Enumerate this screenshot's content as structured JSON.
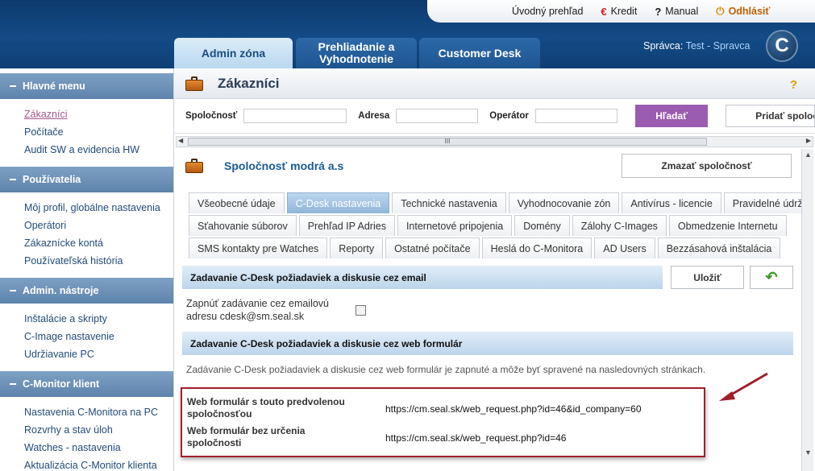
{
  "header": {
    "top_links": [
      {
        "label": "Úvodný prehľad",
        "icon": "none"
      },
      {
        "label": "Kredit",
        "icon": "credit-icon"
      },
      {
        "label": "Manual",
        "icon": "question-icon"
      },
      {
        "label": "Odhlásiť",
        "icon": "power-icon"
      }
    ],
    "tabs": [
      {
        "label": "Admin zóna"
      },
      {
        "label": "Prehliadanie a Vyhodnotenie"
      },
      {
        "label": "Customer Desk"
      }
    ],
    "admin_prefix": "Správca:",
    "admin_name": "Test - Spravca",
    "logo_letter": "C"
  },
  "sidebar": {
    "sections": [
      {
        "title": "Hlavné menu",
        "items": [
          "Zákazníci",
          "Počítače",
          "Audit SW a evidencia HW"
        ]
      },
      {
        "title": "Používatelia",
        "items": [
          "Môj profil, globálne nastavenia",
          "Operátori",
          "Zákaznícke kontá",
          "Používateľská história"
        ]
      },
      {
        "title": "Admin. nástroje",
        "items": [
          "Inštalácie a skripty",
          "C-Image nastavenie",
          "Udržiavanie PC"
        ]
      },
      {
        "title": "C-Monitor klient",
        "items": [
          "Nastavenia C-Monitora na PC",
          "Rozvrhy a stav úloh",
          "Watches - nastavenia",
          "Aktualizácia C-Monitor klienta"
        ]
      }
    ],
    "active_item": "Zákazníci"
  },
  "page": {
    "title": "Zákazníci",
    "help": "?",
    "search": {
      "company_label": "Spoločnosť",
      "address_label": "Adresa",
      "operator_label": "Operátor",
      "search_button": "Hľadať",
      "add_button": "Pridať spoločnosť"
    },
    "scroll_grip": "III",
    "company_name": "Spoločnosť modrá a.s",
    "delete_button": "Zmazať spoločnosť",
    "tabs_row1": [
      "Všeobecné údaje",
      "C-Desk nastavenia",
      "Technické nastavenia",
      "Vyhodnocovanie zón",
      "Antivírus - licencie",
      "Pravidelné údržby"
    ],
    "tabs_row2": [
      "Sťahovanie súborov",
      "Prehľad IP Adries",
      "Internetové pripojenia",
      "Domény",
      "Zálohy C-Images",
      "Obmedzenie Internetu"
    ],
    "tabs_row3": [
      "SMS kontakty pre Watches",
      "Reporty",
      "Ostatné počítače",
      "Heslá do C-Monitora",
      "AD Users",
      "Bezzásahová inštalácia"
    ],
    "active_tab": "C-Desk nastavenia",
    "section_email_title": "Zadavanie C-Desk požiadaviek a diskusie cez email",
    "save_button": "Uložiť",
    "email_option_label": "Zapnúť zadávanie cez emailovú adresu cdesk@sm.seal.sk",
    "email_option_checked": false,
    "section_web_title": "Zadavanie C-Desk požiadaviek a diskusie cez web formulár",
    "web_info": "Zadávanie C-Desk požiadaviek a diskusie cez web formulár je zapnuté a môže byť spravené na nasledovných stránkach.",
    "web_forms": [
      {
        "label": "Web formulár s touto predvolenou spoločnosťou",
        "url": "https://cm.seal.sk/web_request.php?id=46&id_company=60"
      },
      {
        "label": "Web formulár bez určenia spoločnosti",
        "url": "https://cm.seal.sk/web_request.php?id=46"
      }
    ]
  },
  "colors": {
    "header_blue": "#134b86",
    "search_button": "#9a5cb0",
    "highlight_border": "#a01e2a",
    "link_blue": "#234c7a"
  }
}
